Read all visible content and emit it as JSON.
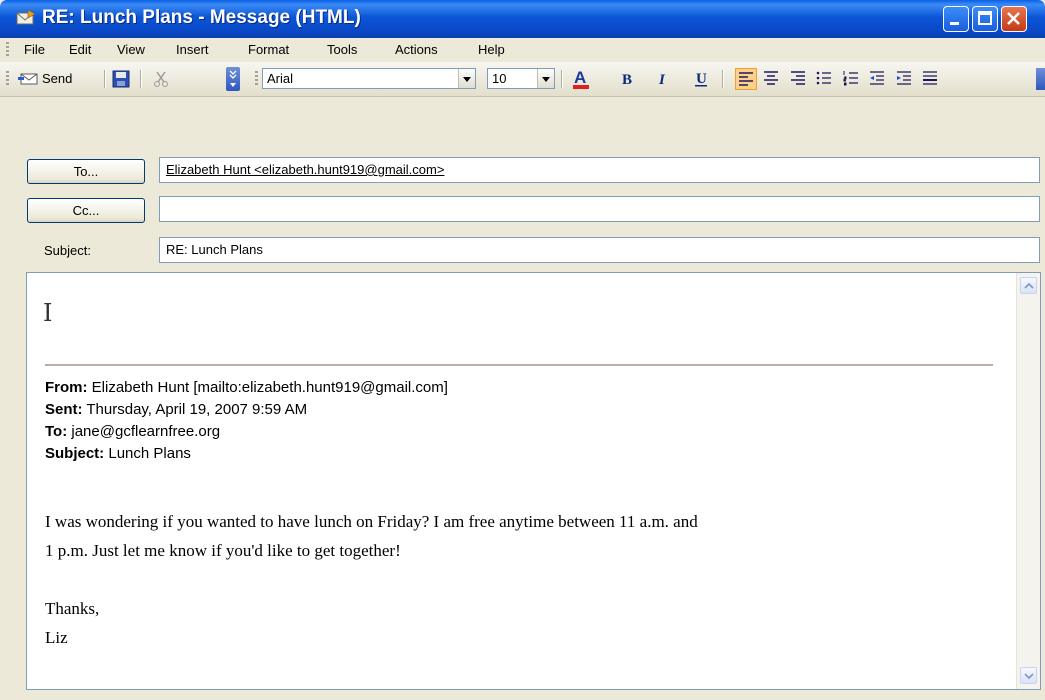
{
  "window": {
    "title": "RE: Lunch Plans - Message (HTML)"
  },
  "menu": {
    "items": [
      {
        "label": "File"
      },
      {
        "label": "Edit"
      },
      {
        "label": "View"
      },
      {
        "label": "Insert"
      },
      {
        "label": "Format"
      },
      {
        "label": "Tools"
      },
      {
        "label": "Actions"
      },
      {
        "label": "Help"
      }
    ]
  },
  "toolbar": {
    "send_label": "Send",
    "font_name": "Arial",
    "font_size": "10"
  },
  "header": {
    "to_button": "To...",
    "cc_button": "Cc...",
    "subject_label": "Subject:",
    "to_value": "Elizabeth Hunt <elizabeth.hunt919@gmail.com>",
    "cc_value": "",
    "subject_value": "RE: Lunch Plans"
  },
  "quoted": {
    "from_label": "From:",
    "from_value": " Elizabeth Hunt [mailto:elizabeth.hunt919@gmail.com]",
    "sent_label": "Sent:",
    "sent_value": " Thursday, April 19, 2007 9:59 AM",
    "to_label": "To:",
    "to_value": " jane@gcflearnfree.org",
    "subject_label": "Subject:",
    "subject_value": " Lunch Plans",
    "body_line1": "I was wondering if you wanted to have lunch on Friday? I am free anytime between 11 a.m. and",
    "body_line2": "1 p.m. Just let me know if you'd like to get together!",
    "closing": "Thanks,",
    "signature": "Liz"
  },
  "colors": {
    "titlebar": "#0a55d7",
    "chrome": "#ece9d8",
    "active_align": "#ffd08a"
  }
}
